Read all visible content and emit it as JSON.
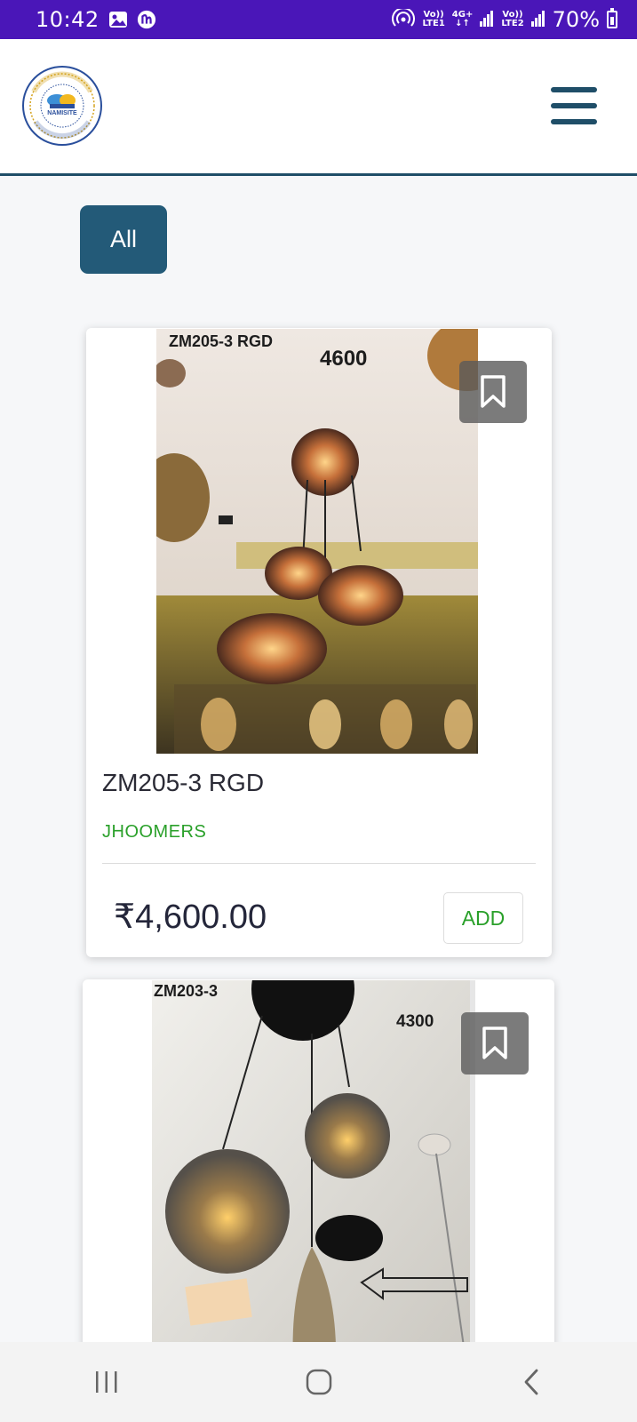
{
  "status_bar": {
    "time": "10:42",
    "net1_top": "Vo))",
    "net1_bottom": "LTE1",
    "net_type": "4G+",
    "net2_top": "Vo))",
    "net2_bottom": "LTE2",
    "battery": "70%",
    "bg_color": "#4a16b8"
  },
  "header": {
    "logo_icon": "namisite-enterprises-logo",
    "logo_text": "NAMISITE",
    "logo_ring_text": "Lets • BB ENTERPRISES • Life with Technology • Catalogue",
    "menu_icon": "hamburger-menu-icon",
    "accent_color": "#1f4e68"
  },
  "filters": {
    "active": "All"
  },
  "products": [
    {
      "image_label": "ZM205-3 RGD",
      "image_price_tag": "4600",
      "title": "ZM205-3 RGD",
      "category": "JHOOMERS",
      "price": "₹4,600.00",
      "add_label": "ADD",
      "bookmark_icon": "bookmark-icon"
    },
    {
      "image_label": "ZM203-3",
      "image_price_tag": "4300",
      "bookmark_icon": "bookmark-icon"
    }
  ],
  "nav_bar": {
    "recents_icon": "recent-apps-icon",
    "home_icon": "home-icon",
    "back_icon": "back-icon"
  }
}
